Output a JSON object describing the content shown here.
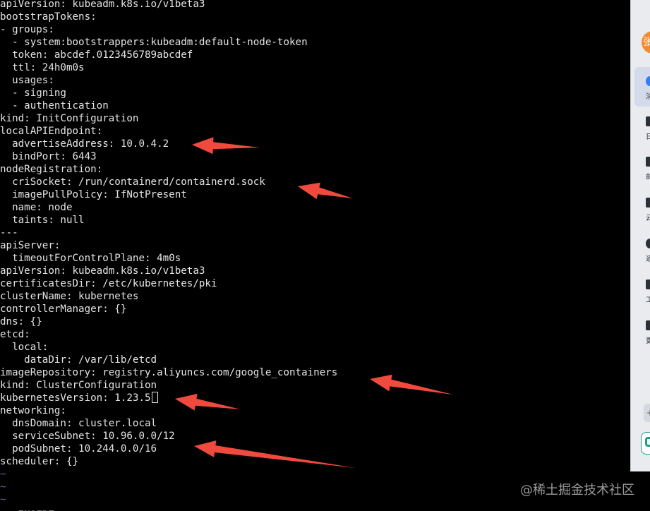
{
  "editor": {
    "lines": [
      "apiVersion: kubeadm.k8s.io/v1beta3",
      "bootstrapTokens:",
      "- groups:",
      "  - system:bootstrappers:kubeadm:default-node-token",
      "  token: abcdef.0123456789abcdef",
      "  ttl: 24h0m0s",
      "  usages:",
      "  - signing",
      "  - authentication",
      "kind: InitConfiguration",
      "localAPIEndpoint:",
      "  advertiseAddress: 10.0.4.2",
      "  bindPort: 6443",
      "nodeRegistration:",
      "  criSocket: /run/containerd/containerd.sock",
      "  imagePullPolicy: IfNotPresent",
      "  name: node",
      "  taints: null",
      "---",
      "apiServer:",
      "  timeoutForControlPlane: 4m0s",
      "apiVersion: kubeadm.k8s.io/v1beta3",
      "certificatesDir: /etc/kubernetes/pki",
      "clusterName: kubernetes",
      "controllerManager: {}",
      "dns: {}",
      "etcd:",
      "  local:",
      "    dataDir: /var/lib/etcd",
      "imageRepository: registry.aliyuncs.com/google_containers",
      "kind: ClusterConfiguration",
      "kubernetesVersion: 1.23.5",
      "networking:",
      "  dnsDomain: cluster.local",
      "  serviceSubnet: 10.96.0.0/12",
      "  podSubnet: 10.244.0.0/16",
      "scheduler: {}"
    ],
    "cursor_line": 31,
    "tilde": "~",
    "mode": "-- INSERT --",
    "arrow_color": "#f04a3e"
  },
  "sidebar": {
    "avatar_text": "张",
    "items": [
      {
        "label": "消",
        "icon": "message-icon"
      },
      {
        "label": "日",
        "icon": "calendar-icon"
      },
      {
        "label": "邮",
        "icon": "mail-icon"
      },
      {
        "label": "云",
        "icon": "cloud-doc-icon"
      },
      {
        "label": "通",
        "icon": "contacts-icon"
      },
      {
        "label": "工",
        "icon": "workbench-icon"
      },
      {
        "label": "更",
        "icon": "more-icon"
      }
    ],
    "button_text": "+"
  },
  "watermark": "@稀土掘金技术社区"
}
